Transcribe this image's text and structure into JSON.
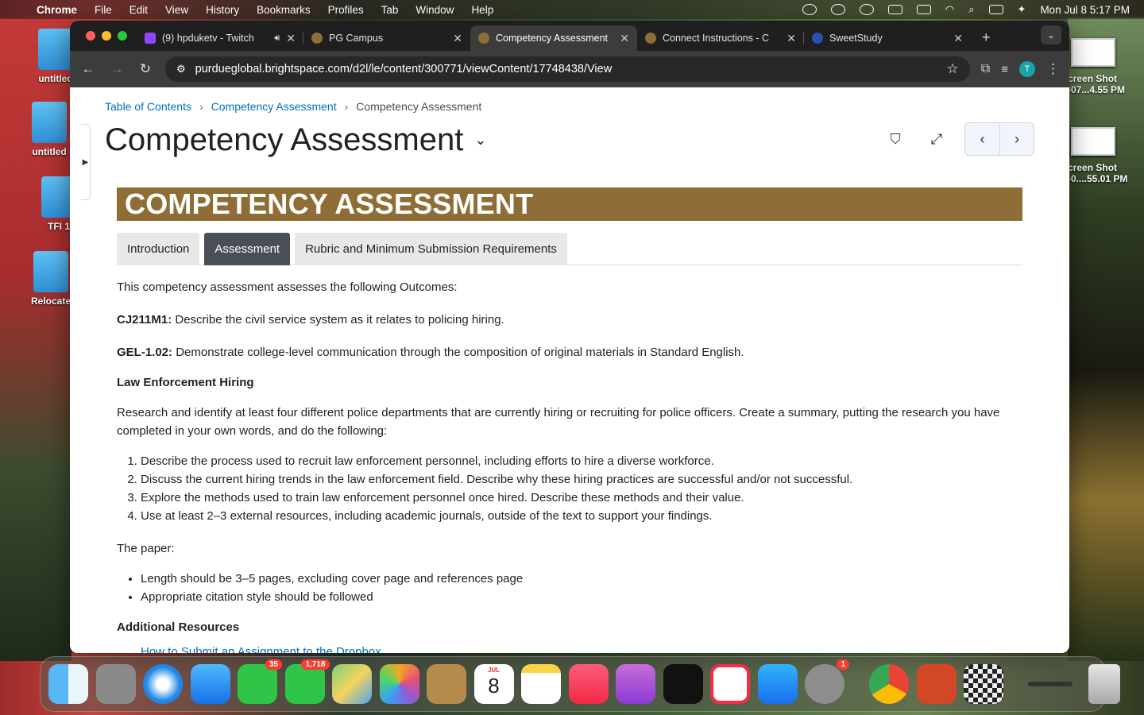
{
  "menubar": {
    "app": "Chrome",
    "items": [
      "File",
      "Edit",
      "View",
      "History",
      "Bookmarks",
      "Profiles",
      "Tab",
      "Window",
      "Help"
    ],
    "clock": "Mon Jul 8  5:17 PM"
  },
  "desktop": {
    "icons": [
      {
        "label": "untitled"
      },
      {
        "label": "untitled"
      },
      {
        "label": "TFI 1"
      },
      {
        "label": "Relocate"
      }
    ],
    "screenshots": [
      {
        "label_line1": "creen Shot",
        "label_line2": "-07...4.55 PM"
      },
      {
        "label_line1": "creen Shot",
        "label_line2": "-0....55.01 PM"
      }
    ]
  },
  "browser": {
    "tabs": [
      {
        "title": "(9) hpduketv - Twitch",
        "favicon_color": "#9146ff",
        "active": false
      },
      {
        "title": "PG Campus",
        "favicon_color": "#8e6e36",
        "active": false
      },
      {
        "title": "Competency Assessment",
        "favicon_color": "#8e6e36",
        "active": true
      },
      {
        "title": "Connect Instructions - C",
        "favicon_color": "#8e6e36",
        "active": false
      },
      {
        "title": "SweetStudy",
        "favicon_color": "#2c4fb5",
        "active": false
      }
    ],
    "url": "purdueglobal.brightspace.com/d2l/le/content/300771/viewContent/17748438/View",
    "profile_initial": "T"
  },
  "page": {
    "breadcrumb": [
      "Table of Contents",
      "Competency Assessment",
      "Competency Assessment"
    ],
    "title": "Competency Assessment",
    "banner": "COMPETENCY ASSESSMENT",
    "content_tabs": [
      "Introduction",
      "Assessment",
      "Rubric and Minimum Submission Requirements"
    ],
    "intro": "This competency assessment assesses the following Outcomes:",
    "outcomes": [
      {
        "code": "CJ211M1:",
        "text": " Describe the civil service system as it relates to policing hiring."
      },
      {
        "code": "GEL-1.02:",
        "text": " Demonstrate college-level communication through the composition of original materials in Standard English."
      }
    ],
    "section_heading": "Law Enforcement Hiring",
    "section_body": "Research and identify at least four different police departments that are currently hiring or recruiting for police officers. Create a summary, putting the research you have completed in your own words, and do the following:",
    "tasks": [
      "Describe the process used to recruit law enforcement personnel, including efforts to hire a diverse workforce.",
      "Discuss the current hiring trends in the law enforcement field. Describe why these hiring practices are successful and/or not successful.",
      "Explore the methods used to train law enforcement personnel once hired. Describe these methods and their value.",
      "Use at least 2–3 external resources, including academic journals, outside of the text to support your findings."
    ],
    "paper_label": "The paper:",
    "paper_requirements": [
      "Length should be 3–5 pages, excluding cover page and references page",
      "Appropriate citation style should be followed"
    ],
    "resources_heading": "Additional Resources",
    "resources_link": "How to Submit an Assignment to the Dropbox"
  },
  "dock": {
    "facetime_badge": "35",
    "messages_badge": "1,718",
    "calendar_month": "JUL",
    "calendar_day": "8",
    "settings_badge": "1"
  }
}
